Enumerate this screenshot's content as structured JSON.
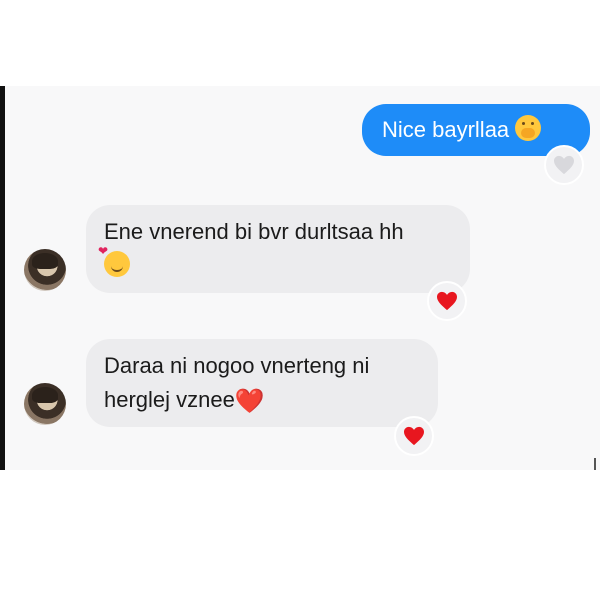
{
  "colors": {
    "outgoing_bubble": "#1e8cf8",
    "incoming_bubble": "#ececee",
    "reaction_heart": "#e8161f",
    "reaction_heart_outgoing": "#d8d8dc"
  },
  "messages": [
    {
      "direction": "outgoing",
      "text": "Nice bayrllaa",
      "emoji_icon": "hand-over-mouth-emoji-icon",
      "reaction_icon": "heart-gray-icon"
    },
    {
      "direction": "incoming",
      "text": "Ene vnerend bi bvr durltsaa hh",
      "emoji_icon": "smiling-face-with-hearts-emoji-icon",
      "reaction_icon": "heart-red-icon"
    },
    {
      "direction": "incoming",
      "line1": "Daraa ni nogoo vnerteng ni",
      "line2": "herglej vznee",
      "trailing_emoji": "❤️",
      "reaction_icon": "heart-red-icon"
    }
  ]
}
